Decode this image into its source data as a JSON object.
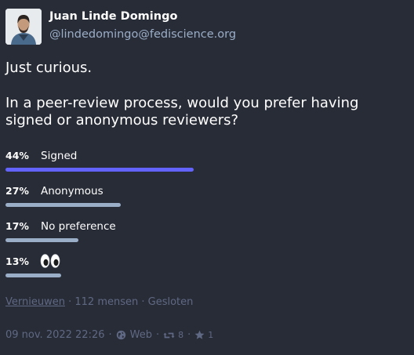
{
  "author": {
    "display_name": "Juan Linde Domingo",
    "handle": "@lindedomingo@fediscience.org"
  },
  "status": {
    "paragraphs": [
      "Just curious.",
      "In a peer-review process, would you prefer having signed or anonymous reviewers?"
    ]
  },
  "poll": {
    "options": [
      {
        "percent_text": "44%",
        "label": "Signed",
        "fraction": 0.44,
        "leading": true
      },
      {
        "percent_text": "27%",
        "label": "Anonymous",
        "fraction": 0.27,
        "leading": false
      },
      {
        "percent_text": "17%",
        "label": "No preference",
        "fraction": 0.17,
        "leading": false
      },
      {
        "percent_text": "13%",
        "label": "",
        "icon": "eyes-emoji",
        "fraction": 0.13,
        "leading": false
      }
    ],
    "refresh_label": "Vernieuwen",
    "voters": "112 mensen",
    "state": "Gesloten"
  },
  "meta": {
    "timestamp": "09 nov. 2022 22:26",
    "application": "Web",
    "boosts": "8",
    "favourites": "1"
  },
  "colors": {
    "background": "#282c37",
    "leading_bar": "#6364ff",
    "bar": "#9baec8",
    "muted": "#606984"
  }
}
